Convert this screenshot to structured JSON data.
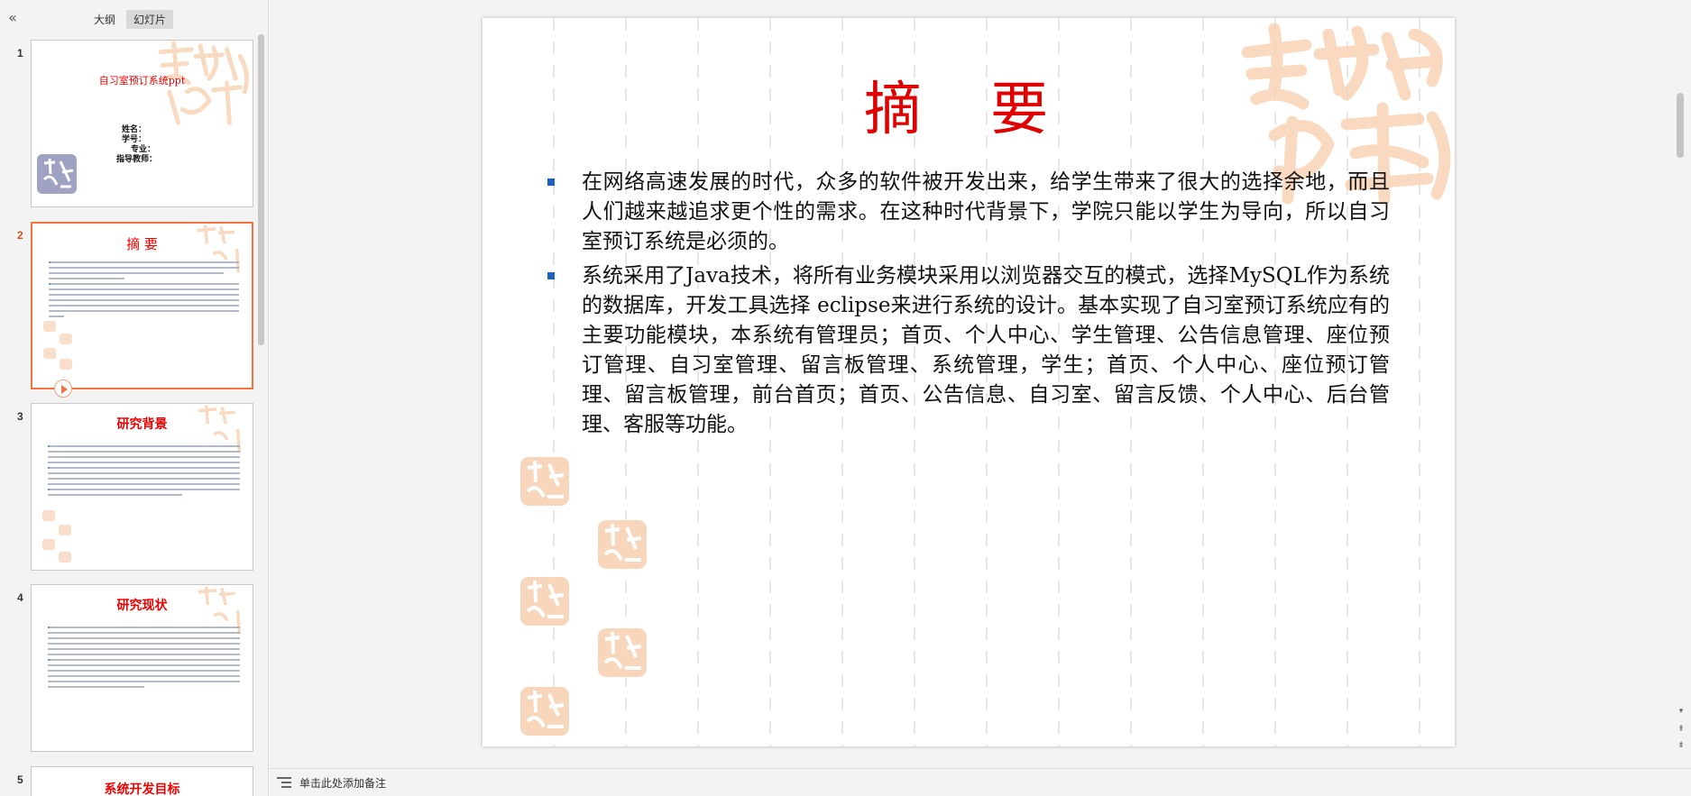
{
  "sidebar": {
    "tabs": [
      "大纲",
      "幻灯片"
    ],
    "active_tab": "幻灯片",
    "thumbnails": [
      {
        "num": "1",
        "title": "自习室预订系统ppt",
        "fields": [
          "姓名：",
          "学号：",
          "专业：",
          "指导教师："
        ]
      },
      {
        "num": "2",
        "title": "摘  要"
      },
      {
        "num": "3",
        "title": "研究背景"
      },
      {
        "num": "4",
        "title": "研究现状"
      },
      {
        "num": "5",
        "title": "系统开发目标"
      }
    ],
    "active_slide": "2"
  },
  "slide": {
    "title": "摘 要",
    "bullets": [
      "在网络高速发展的时代，众多的软件被开发出来，给学生带来了很大的选择余地，而且人们越来越追求更个性的需求。在这种时代背景下，学院只能以学生为导向，所以自习室预订系统是必须的。",
      "系统采用了Java技术，将所有业务模块采用以浏览器交互的模式，选择MySQL作为系统的数据库，开发工具选择 eclipse来进行系统的设计。基本实现了自习室预订系统应有的主要功能模块，本系统有管理员；首页、个人中心、学生管理、公告信息管理、座位预订管理、自习室管理、留言板管理、系统管理，学生；首页、个人中心、座位预订管理、留言板管理，前台首页；首页、公告信息、自习室、留言反馈、个人中心、后台管理、客服等功能。"
    ]
  },
  "notes": {
    "placeholder": "单击此处添加备注"
  },
  "colors": {
    "title_red": "#e00000",
    "bullet_blue": "#1e5fbf",
    "active_orange": "#f4743f",
    "watermark": "#f6cba6"
  },
  "icons": [
    "collapse-panel-icon",
    "play-icon",
    "notes-icon",
    "scroll-arrow-icon"
  ]
}
